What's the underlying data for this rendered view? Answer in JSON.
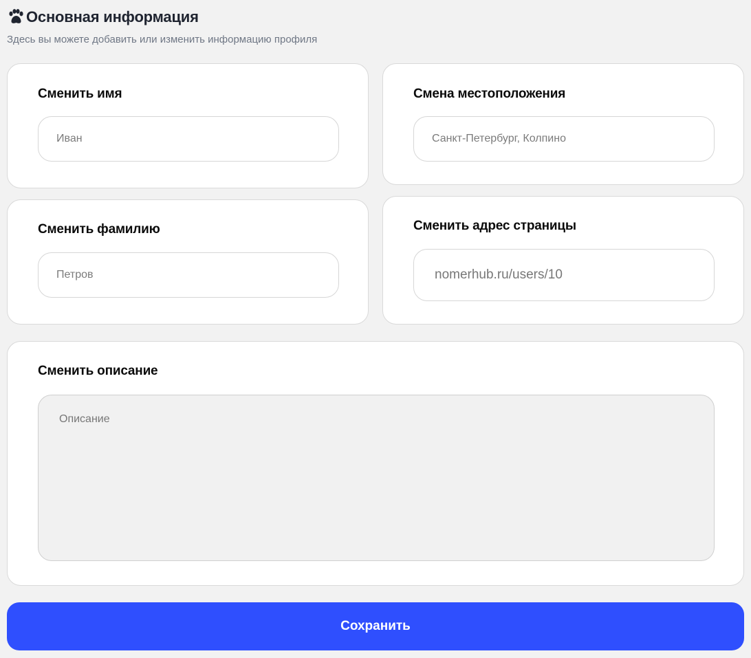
{
  "header": {
    "icon": "paw-icon",
    "title": "Основная информация",
    "subtitle": "Здесь вы можете добавить или изменить информацию профиля"
  },
  "first_name": {
    "label": "Сменить имя",
    "placeholder": "Иван"
  },
  "location": {
    "label": "Смена местоположения",
    "placeholder": "Санкт-Петербург, Колпино"
  },
  "last_name": {
    "label": "Сменить фамилию",
    "placeholder": "Петров"
  },
  "page_address": {
    "label": "Сменить адрес страницы",
    "placeholder": "nomerhub.ru/users/10"
  },
  "description": {
    "label": "Сменить описание",
    "placeholder": "Описание"
  },
  "save_button": {
    "label": "Сохранить"
  },
  "colors": {
    "background": "#f2f2f2",
    "accent": "#2f4ffe",
    "title": "#1f2430",
    "subtitle": "#6f7785"
  }
}
